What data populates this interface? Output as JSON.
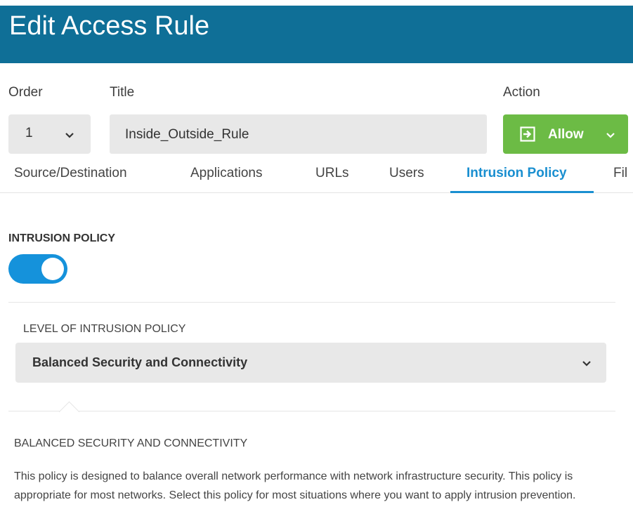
{
  "header": {
    "title": "Edit Access Rule"
  },
  "labels": {
    "order": "Order",
    "title": "Title",
    "action": "Action"
  },
  "order": {
    "value": "1"
  },
  "title_field": {
    "value": "Inside_Outside_Rule"
  },
  "action": {
    "label": "Allow",
    "color": "#6cbb45"
  },
  "tabs": [
    {
      "label": "Source/Destination"
    },
    {
      "label": "Applications"
    },
    {
      "label": "URLs"
    },
    {
      "label": "Users"
    },
    {
      "label": "Intrusion Policy",
      "active": true
    },
    {
      "label": "Fil"
    }
  ],
  "intrusion": {
    "section_title": "INTRUSION POLICY",
    "enabled": true,
    "level_label": "LEVEL OF INTRUSION POLICY",
    "level_value": "Balanced Security and Connectivity",
    "desc_title": "BALANCED SECURITY AND CONNECTIVITY",
    "desc_text": "This policy is designed to balance overall network performance with network infrastructure security. This policy is appropriate for most networks. Select this policy for most situations where you want to apply intrusion prevention."
  },
  "colors": {
    "header": "#0f6f97",
    "accent": "#1a8fd0",
    "toggle": "#1592db"
  }
}
